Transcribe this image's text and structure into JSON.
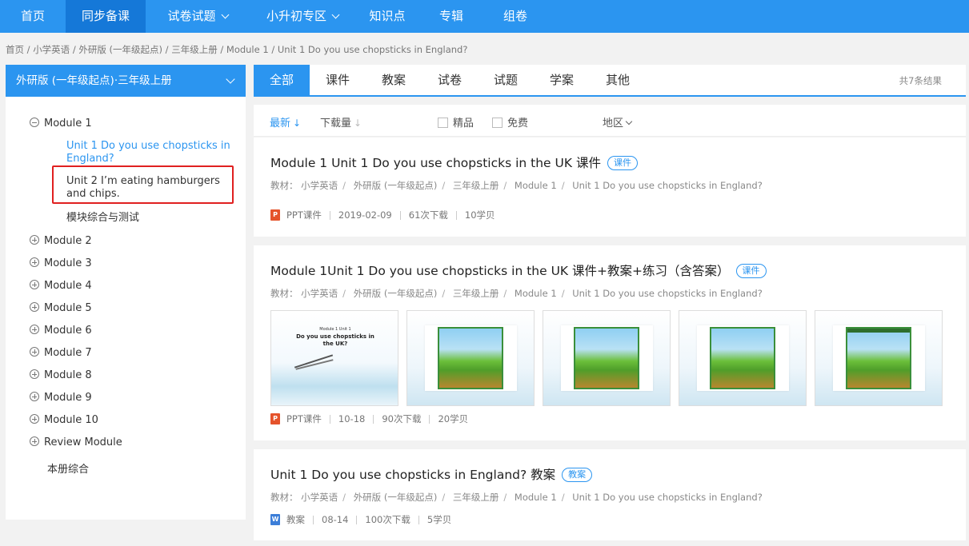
{
  "nav": {
    "items": [
      {
        "label": "首页",
        "active": false,
        "dropdown": false
      },
      {
        "label": "同步备课",
        "active": true,
        "dropdown": false
      },
      {
        "label": "试卷试题",
        "active": false,
        "dropdown": true
      },
      {
        "label": "小升初专区",
        "active": false,
        "dropdown": true
      },
      {
        "label": "知识点",
        "active": false,
        "dropdown": false
      },
      {
        "label": "专辑",
        "active": false,
        "dropdown": false
      },
      {
        "label": "组卷",
        "active": false,
        "dropdown": false
      }
    ],
    "color": "#2b95f0",
    "active_color": "#1578d8"
  },
  "breadcrumb": [
    "首页",
    "小学英语",
    "外研版 (一年级起点)",
    "三年级上册",
    "Module 1",
    "Unit 1 Do you use chopsticks in England?"
  ],
  "sidebar": {
    "header": "外研版 (一年级起点)·三年级上册",
    "modules": [
      {
        "label": "Module 1",
        "expanded": true,
        "children": [
          {
            "label": "Unit 1 Do you use chopsticks in England?",
            "selected": true
          },
          {
            "label": "Unit 2 I’m eating hamburgers and chips.",
            "selected": false
          },
          {
            "label": "模块综合与测试",
            "selected": false
          }
        ]
      },
      {
        "label": "Module 2",
        "expanded": false
      },
      {
        "label": "Module 3",
        "expanded": false
      },
      {
        "label": "Module 4",
        "expanded": false
      },
      {
        "label": "Module 5",
        "expanded": false
      },
      {
        "label": "Module 6",
        "expanded": false
      },
      {
        "label": "Module 7",
        "expanded": false
      },
      {
        "label": "Module 8",
        "expanded": false
      },
      {
        "label": "Module 9",
        "expanded": false
      },
      {
        "label": "Module 10",
        "expanded": false
      },
      {
        "label": "Review Module",
        "expanded": false
      }
    ],
    "extra": "本册综合"
  },
  "tabs": {
    "items": [
      "全部",
      "课件",
      "教案",
      "试卷",
      "试题",
      "学案",
      "其他"
    ],
    "active_index": 0,
    "result_count": "共7条结果"
  },
  "filters": {
    "sort_newest": "最新",
    "sort_downloads": "下载量",
    "quality": "精品",
    "free": "免费",
    "region": "地区"
  },
  "results": [
    {
      "title": "Module 1 Unit 1 Do you use chopsticks in the UK 课件",
      "badge": "课件",
      "meta_label": "教材：",
      "meta": [
        "小学英语",
        "外研版 (一年级起点)",
        "三年级上册",
        "Module 1",
        "Unit 1 Do you use chopsticks in England?"
      ],
      "file_type_icon": "ppt-file-icon",
      "file_type": "PPT课件",
      "date": "2019-02-09",
      "downloads": "61次下载",
      "pages": "10学贝"
    },
    {
      "title": "Module 1Unit 1 Do you use chopsticks in the UK 课件+教案+练习（含答案）",
      "badge": "课件",
      "meta_label": "教材：",
      "meta": [
        "小学英语",
        "外研版 (一年级起点)",
        "三年级上册",
        "Module 1",
        "Unit 1 Do you use chopsticks in England?"
      ],
      "thumbnails": {
        "cover_small": "Module 1 Unit 1",
        "cover_title": "Do you use chopsticks in the UK?"
      },
      "file_type_icon": "ppt-file-icon",
      "file_type": "PPT课件",
      "date": "10-18",
      "downloads": "90次下载",
      "pages": "20学贝"
    },
    {
      "title": "Unit 1 Do you use chopsticks in England? 教案",
      "badge": "教案",
      "meta_label": "教材：",
      "meta": [
        "小学英语",
        "外研版 (一年级起点)",
        "三年级上册",
        "Module 1",
        "Unit 1 Do you use chopsticks in England?"
      ],
      "file_type_icon": "word-file-icon",
      "file_type": "教案",
      "date": "08-14",
      "downloads": "100次下载",
      "pages": "5学贝"
    }
  ]
}
